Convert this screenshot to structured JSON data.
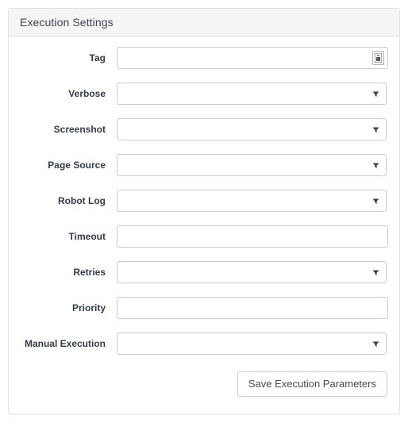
{
  "panel": {
    "title": "Execution Settings"
  },
  "form": {
    "rows": [
      {
        "label": "Tag",
        "type": "text",
        "value": "",
        "placeholder": "",
        "name": "tag",
        "addon_icon": "tag-picker-icon"
      },
      {
        "label": "Verbose",
        "type": "select",
        "value": "",
        "name": "verbose"
      },
      {
        "label": "Screenshot",
        "type": "select",
        "value": "",
        "name": "screenshot"
      },
      {
        "label": "Page Source",
        "type": "select",
        "value": "",
        "name": "page-source"
      },
      {
        "label": "Robot Log",
        "type": "select",
        "value": "",
        "name": "robot-log"
      },
      {
        "label": "Timeout",
        "type": "text",
        "value": "",
        "placeholder": "",
        "name": "timeout"
      },
      {
        "label": "Retries",
        "type": "select",
        "value": "",
        "name": "retries"
      },
      {
        "label": "Priority",
        "type": "text",
        "value": "",
        "placeholder": "",
        "name": "priority"
      },
      {
        "label": "Manual Execution",
        "type": "select",
        "value": "",
        "name": "manual-execution"
      }
    ]
  },
  "footer": {
    "save_label": "Save Execution Parameters"
  },
  "colors": {
    "header_bg": "#f5f5f5",
    "panel_border": "#e3e3e3",
    "field_border": "#cccccc",
    "label_text": "#333c4a",
    "title_text": "#3c444f"
  }
}
